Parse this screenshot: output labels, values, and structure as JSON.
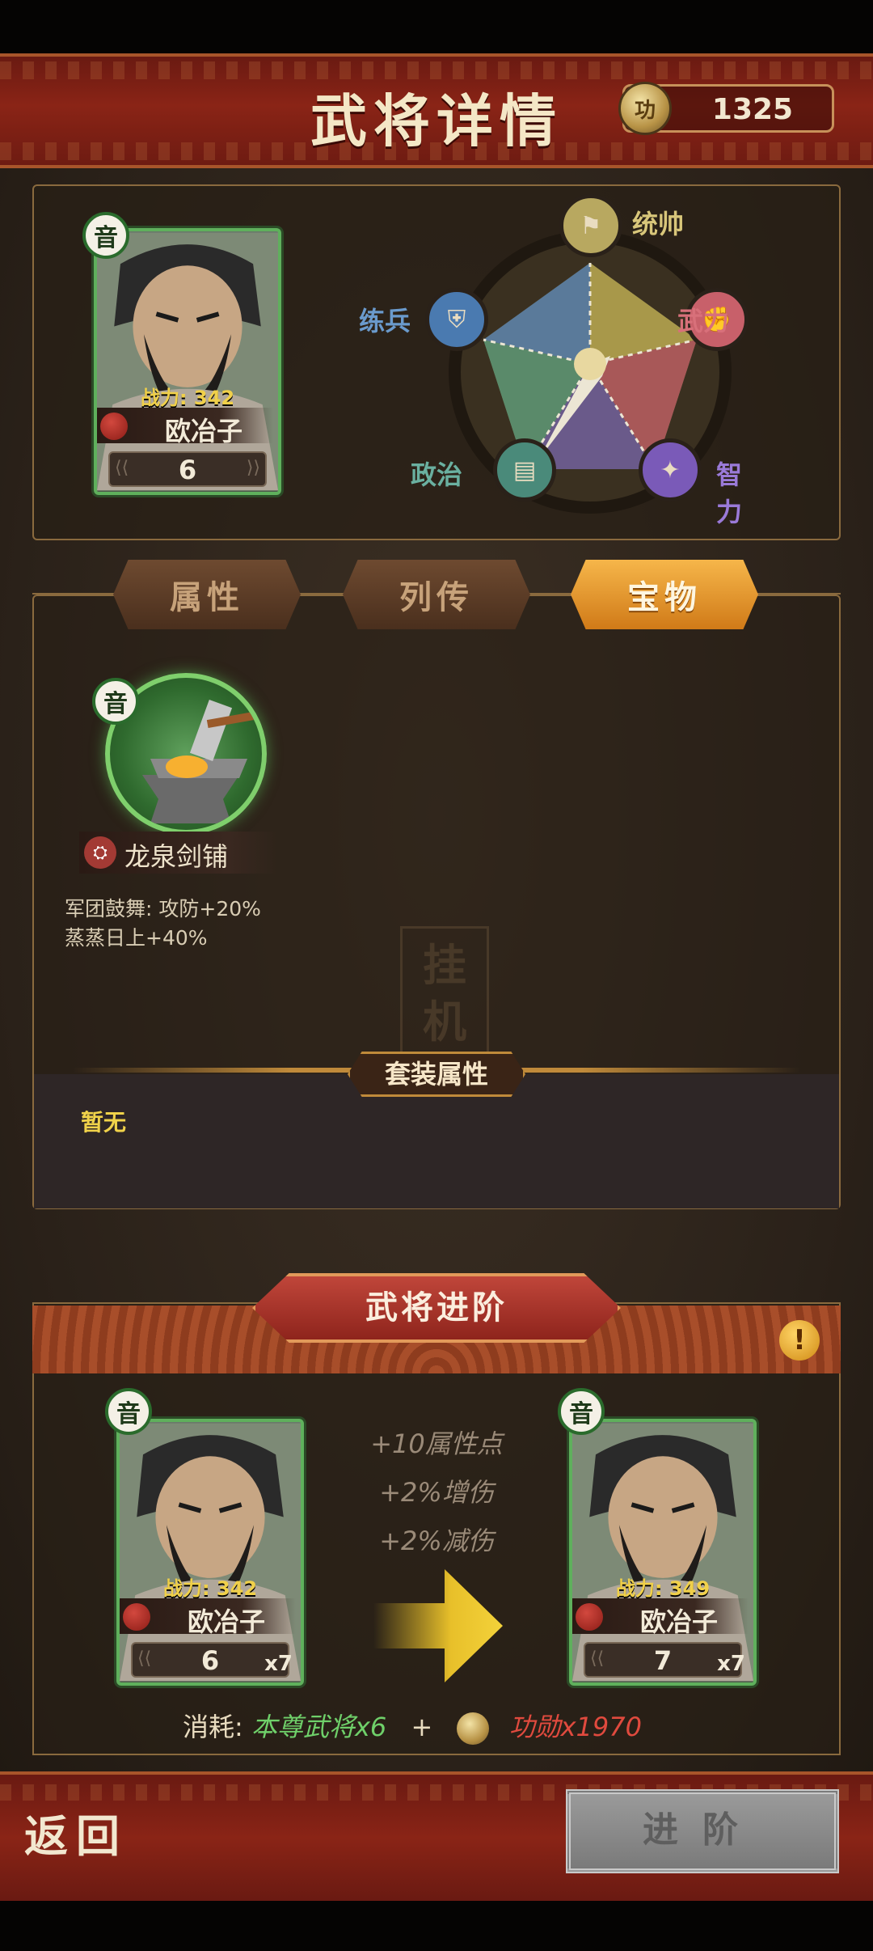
{
  "header": {
    "title": "武将详情",
    "coins": "1325",
    "coin_glyph": "功"
  },
  "hero": {
    "badge": "音",
    "power": "战力: 342",
    "name": "欧冶子",
    "level": "6"
  },
  "radar": {
    "stats": [
      {
        "key": "tongshuai",
        "label": "统帅",
        "color": "#d8c67a",
        "icon": "flag-icon"
      },
      {
        "key": "wuli",
        "label": "武力",
        "color": "#d8707a",
        "icon": "fist-icon"
      },
      {
        "key": "zhili",
        "label": "智力",
        "color": "#9a7ad8",
        "icon": "star-icon"
      },
      {
        "key": "zhengzhi",
        "label": "政治",
        "color": "#6ab0a0",
        "icon": "scroll-icon"
      },
      {
        "key": "lianbing",
        "label": "练兵",
        "color": "#6a9acc",
        "icon": "armor-icon"
      }
    ]
  },
  "tabs": [
    {
      "label": "属性",
      "active": false
    },
    {
      "label": "列传",
      "active": false
    },
    {
      "label": "宝物",
      "active": true
    }
  ],
  "treasure": {
    "badge": "音",
    "name": "龙泉剑铺",
    "effects": [
      "军团鼓舞: 攻防+20%",
      "蒸蒸日上+40%"
    ]
  },
  "watermark": "挂机",
  "set_attr": {
    "title": "套装属性",
    "empty_text": "暂无"
  },
  "advance": {
    "title": "武将进阶",
    "bonuses": [
      "+10属性点",
      "+2%增伤",
      "+2%减伤"
    ],
    "before": {
      "badge": "音",
      "power": "战力: 342",
      "name": "欧冶子",
      "level": "6",
      "count": "x7"
    },
    "after": {
      "badge": "音",
      "power": "战力: 349",
      "name": "欧冶子",
      "level": "7",
      "count": "x7"
    },
    "cost_label": "消耗:",
    "cost_material": "本尊武将x6",
    "cost_plus": "+",
    "cost_merit": "功勋x1970"
  },
  "footer": {
    "back_label": "返回",
    "advance_button": "进阶"
  }
}
